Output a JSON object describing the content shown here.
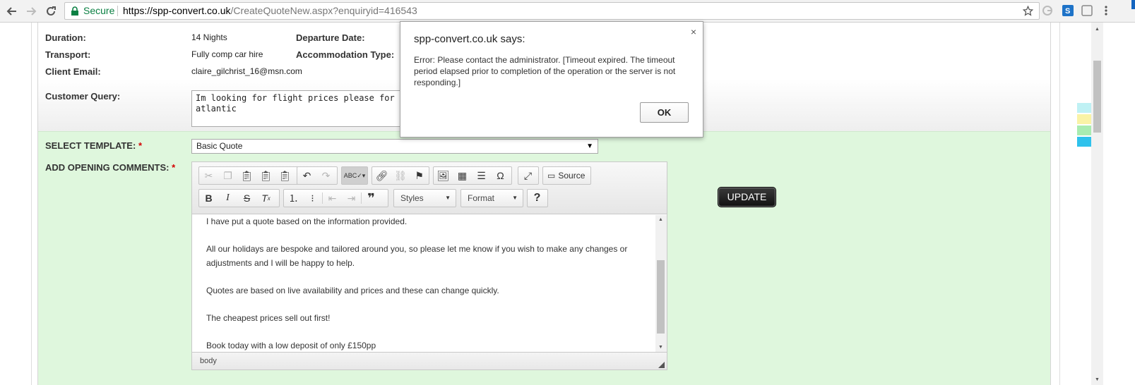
{
  "browser": {
    "secure_label": "Secure",
    "url_host": "https://spp-convert.co.uk",
    "url_path": "/CreateQuoteNew.aspx?enquiryid=416543"
  },
  "form": {
    "duration_label": "Duration:",
    "duration_value": "14 Nights",
    "departure_label": "Departure Date:",
    "transport_label": "Transport:",
    "transport_value": "Fully comp car hire",
    "accommodation_label": "Accommodation Type:",
    "email_label": "Client Email:",
    "email_value": "claire_gilchrist_16@msn.com",
    "query_label": "Customer Query:",
    "query_value": "Im looking for flight prices please for 2\natlantic",
    "template_label": "SELECT TEMPLATE:",
    "template_value": "Basic Quote",
    "comments_label": "ADD OPENING COMMENTS:",
    "required_mark": "*"
  },
  "editor": {
    "styles_label": "Styles",
    "format_label": "Format",
    "source_label": "Source",
    "help_label": "?",
    "status_path": "body",
    "paragraphs": [
      "I have put a quote based on the information provided.",
      "All our holidays are bespoke and tailored around you, so please let me know if you wish to make any changes or adjustments and I will be happy to help.",
      "Quotes are based on live availability and prices and these can change quickly.",
      "The cheapest prices sell out first!",
      "Book today with a low deposit of only £150pp"
    ]
  },
  "update_label": "UPDATE",
  "dialog": {
    "title": "spp-convert.co.uk says:",
    "message": "Error: Please contact the administrator. [Timeout expired.  The timeout period elapsed prior to completion of the operation or the server is not responding.]",
    "ok_label": "OK",
    "close_glyph": "×"
  },
  "colors": {
    "green_panel": "#dff7dd",
    "secure_green": "#0b8043",
    "required_red": "#d40000"
  }
}
